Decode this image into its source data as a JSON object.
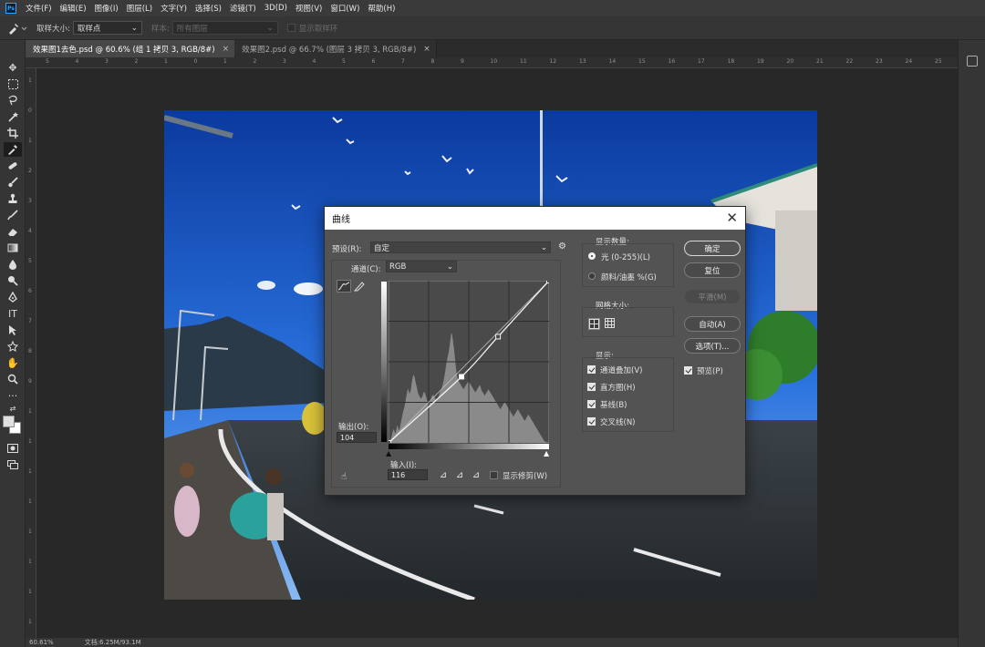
{
  "menu": {
    "logo": "Ps",
    "items": [
      "文件(F)",
      "编辑(E)",
      "图像(I)",
      "图层(L)",
      "文字(Y)",
      "选择(S)",
      "滤镜(T)",
      "3D(D)",
      "视图(V)",
      "窗口(W)",
      "帮助(H)"
    ]
  },
  "options": {
    "sample_size_label": "取样大小:",
    "sample_size_value": "取样点",
    "sample_label": "样本:",
    "sample_value": "所有图层",
    "show_ring_label": "显示取样环"
  },
  "tabs": [
    {
      "title": "效果图1去色.psd @ 60.6% (组 1 拷贝 3, RGB/8#)",
      "close": "×"
    },
    {
      "title": "效果图2.psd @ 66.7% (图层 3 拷贝 3, RGB/8#)",
      "close": "×"
    }
  ],
  "ruler": {
    "h_ticks": [
      "5",
      "4",
      "3",
      "2",
      "1",
      "0",
      "1",
      "2",
      "3",
      "4",
      "5",
      "6",
      "7",
      "8",
      "9",
      "10",
      "11",
      "12",
      "13",
      "14",
      "15",
      "16",
      "17",
      "18",
      "19",
      "20",
      "21",
      "22",
      "23",
      "24",
      "25"
    ],
    "v_ticks": [
      "1",
      "0",
      "1",
      "2",
      "3",
      "4",
      "5",
      "6",
      "7",
      "8",
      "9",
      "1",
      "1",
      "1",
      "1",
      "1",
      "1",
      "1",
      "1"
    ]
  },
  "status": {
    "zoom": "60.61%",
    "doc": "文档:6.25M/93.1M"
  },
  "curves": {
    "title": "曲线",
    "close": "✕",
    "preset_label": "预设(R):",
    "preset_value": "自定",
    "channel_label": "通道(C):",
    "channel_value": "RGB",
    "output_label": "输出(O):",
    "output_value": "104",
    "input_label": "输入(I):",
    "input_value": "116",
    "show_clipping_label": "显示修剪(W)",
    "display_amount_title": "显示数量:",
    "light_label": "光 (0-255)(L)",
    "pigment_label": "颜料/油墨 %(G)",
    "grid_size_title": "网格大小:",
    "show_title": "显示:",
    "show_options": [
      "通道叠加(V)",
      "直方图(H)",
      "基线(B)",
      "交叉线(N)"
    ],
    "buttons": {
      "ok": "确定",
      "reset": "复位",
      "smooth": "平滑(M)",
      "auto": "自动(A)",
      "options": "选项(T)..."
    },
    "preview_label": "预览(P)",
    "curve_points": [
      [
        0,
        0
      ],
      [
        116,
        104
      ],
      [
        174,
        167
      ],
      [
        255,
        255
      ]
    ],
    "histogram": [
      2,
      3,
      4,
      6,
      8,
      12,
      18,
      22,
      26,
      24,
      20,
      18,
      22,
      28,
      34,
      30,
      26,
      24,
      28,
      34,
      40,
      46,
      52,
      58,
      62,
      66,
      72,
      78,
      86,
      92,
      98,
      104,
      100,
      96,
      94,
      98,
      104,
      112,
      120,
      126,
      130,
      128,
      124,
      118,
      112,
      108,
      102,
      96,
      92,
      90,
      88,
      86,
      84,
      86,
      88,
      92,
      96,
      98,
      96,
      92,
      88,
      84,
      80,
      78,
      76,
      74,
      76,
      80,
      84,
      88,
      90,
      92,
      90,
      88,
      86,
      84,
      82,
      80,
      82,
      84,
      88,
      92,
      96,
      98,
      100,
      104,
      108,
      112,
      118,
      124,
      130,
      138,
      146,
      154,
      160,
      166,
      170,
      178,
      186,
      196,
      206,
      210,
      204,
      196,
      186,
      178,
      166,
      154,
      142,
      132,
      126,
      122,
      118,
      116,
      114,
      112,
      110,
      108,
      106,
      104,
      102,
      104,
      106,
      108,
      110,
      112,
      114,
      116,
      118,
      116,
      114,
      112,
      110,
      108,
      106,
      104,
      102,
      100,
      98,
      96,
      98,
      100,
      102,
      104,
      106,
      108,
      110,
      108,
      104,
      100,
      98,
      96,
      94,
      92,
      90,
      92,
      94,
      96,
      98,
      100,
      102,
      100,
      98,
      96,
      94,
      92,
      90,
      88,
      86,
      84,
      82,
      80,
      78,
      76,
      74,
      72,
      70,
      68,
      66,
      64,
      66,
      68,
      70,
      72,
      74,
      76,
      78,
      76,
      74,
      72,
      70,
      68,
      66,
      64,
      62,
      60,
      58,
      56,
      54,
      52,
      50,
      52,
      54,
      56,
      58,
      60,
      62,
      64,
      62,
      60,
      58,
      56,
      54,
      52,
      50,
      48,
      46,
      44,
      42,
      44,
      46,
      48,
      50,
      52,
      54,
      52,
      50,
      48,
      46,
      44,
      42,
      40,
      38,
      36,
      34,
      32,
      30,
      28,
      26,
      24,
      22,
      20,
      18,
      16,
      14,
      12,
      10,
      8,
      6,
      4,
      3,
      2,
      2,
      1,
      1,
      1,
      1,
      1
    ]
  },
  "colors": {
    "app_bg": "#282828",
    "panel": "#353535",
    "dialog_bg": "#535353",
    "accent": "#31a8ff"
  }
}
